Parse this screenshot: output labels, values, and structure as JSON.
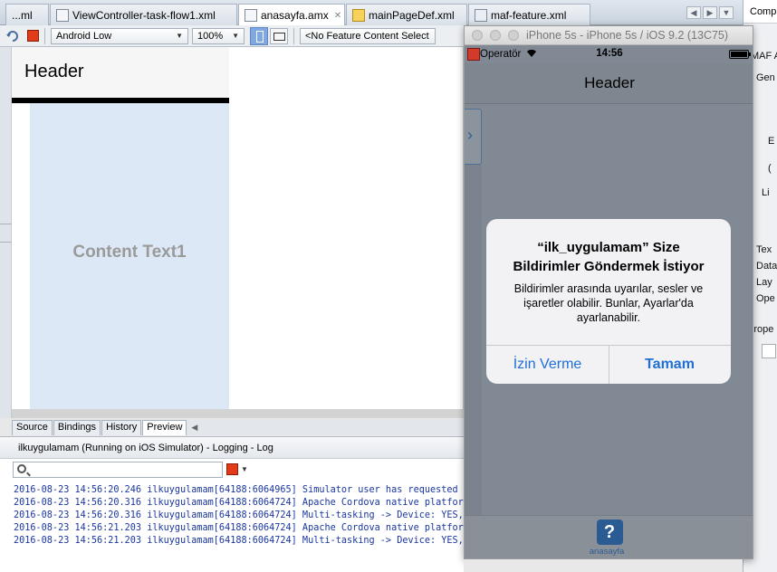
{
  "editor_tabs": [
    {
      "label": "...ml"
    },
    {
      "label": "ViewController-task-flow1.xml"
    },
    {
      "label": "anasayfa.amx"
    },
    {
      "label": "mainPageDef.xml"
    },
    {
      "label": "maf-feature.xml"
    }
  ],
  "right_panel": {
    "tab": "Comp",
    "lines": [
      "MAF A",
      "Gen",
      "E",
      "(",
      "Li",
      "Tex",
      "Data",
      "Lay",
      "Ope",
      "Prope"
    ]
  },
  "toolbar": {
    "device": "Android Low",
    "zoom": "100%",
    "feature": "<No Feature Content Select"
  },
  "design": {
    "header": "Header",
    "content_text": "Content Text1"
  },
  "bottom_tabs": [
    "Source",
    "Bindings",
    "History",
    "Preview"
  ],
  "log": {
    "title": "ilkuygulamam (Running on iOS Simulator) - Logging - Log",
    "lines": [
      "2016-08-23 14:56:20.246 ilkuygulamam[64188:6064965] Simulator user has requested new",
      "2016-08-23 14:56:20.316 ilkuygulamam[64188:6064724] Apache Cordova native platform v",
      "2016-08-23 14:56:20.316 ilkuygulamam[64188:6064724] Multi-tasking -> Device: YES, App",
      "2016-08-23 14:56:21.203 ilkuygulamam[64188:6064724] Apache Cordova native platform v",
      "2016-08-23 14:56:21.203 ilkuygulamam[64188:6064724] Multi-tasking -> Device: YES, App"
    ]
  },
  "simulator": {
    "window_title": "iPhone 5s - iPhone 5s / iOS 9.2 (13C75)",
    "carrier": "Operatör",
    "time": "14:56",
    "header": "Header",
    "tab_label": "anasayfa",
    "tab_glyph": "?",
    "alert": {
      "title_line1": "“ilk_uygulamam” Size",
      "title_line2": "Bildirimler Göndermek İstiyor",
      "message": "Bildirimler arasında uyarılar, sesler ve işaretler olabilir. Bunlar, Ayarlar'da ayarlanabilir.",
      "deny": "İzin Verme",
      "ok": "Tamam"
    }
  }
}
